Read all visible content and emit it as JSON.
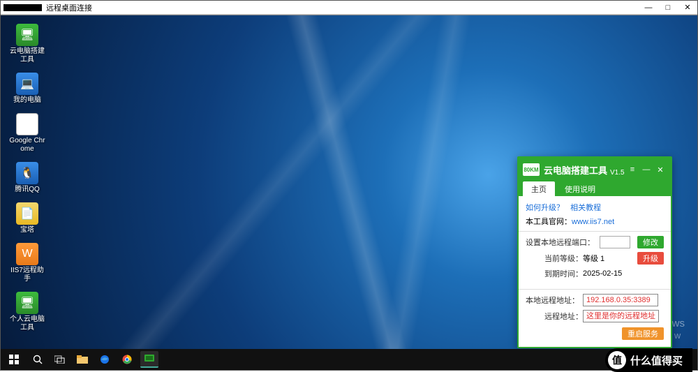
{
  "window": {
    "title": "远程桌面连接",
    "minimize": "—",
    "maximize": "□",
    "close": "✕"
  },
  "desktop_icons": [
    {
      "label": "云电脑搭建工具",
      "cls": "i-green",
      "glyph": "🖥"
    },
    {
      "label": "我的电脑",
      "cls": "i-blue",
      "glyph": "💻"
    },
    {
      "label": "Google Chrome",
      "cls": "i-white",
      "glyph": "◎"
    },
    {
      "label": "腾讯QQ",
      "cls": "i-blue",
      "glyph": "🐧"
    },
    {
      "label": "宝塔",
      "cls": "i-yellow",
      "glyph": "📄"
    },
    {
      "label": "IIS7远程助手",
      "cls": "i-orange",
      "glyph": "W"
    },
    {
      "label": "个人云电脑工具",
      "cls": "i-green",
      "glyph": "🖥"
    }
  ],
  "watermark": {
    "line1": "激活 Windows",
    "line2": "转到\"设置\"以激活 W"
  },
  "app": {
    "logo": "80KM",
    "title": "云电脑搭建工具",
    "version": "V1.5",
    "tabs": [
      "主页",
      "使用说明"
    ],
    "active_tab": 0,
    "upgrade_link": "如何升级？",
    "tutorial_link": "相关教程",
    "site_label": "本工具官网：",
    "site_url": "www.iis7.net",
    "port_label": "设置本地远程端口：",
    "port_value": "",
    "modify_btn": "修改",
    "level_label": "当前等级：",
    "level_value": "等级 1",
    "upgrade_btn": "升级",
    "expire_label": "到期时间：",
    "expire_value": "2025-02-15",
    "local_addr_label": "本地远程地址：",
    "local_addr_value": "192.168.0.35:3389",
    "remote_addr_label": "远程地址：",
    "remote_addr_value": "这里是你的远程地址",
    "restart_btn": "重启服务"
  },
  "badge": {
    "circle": "值",
    "text": "什么值得买"
  }
}
